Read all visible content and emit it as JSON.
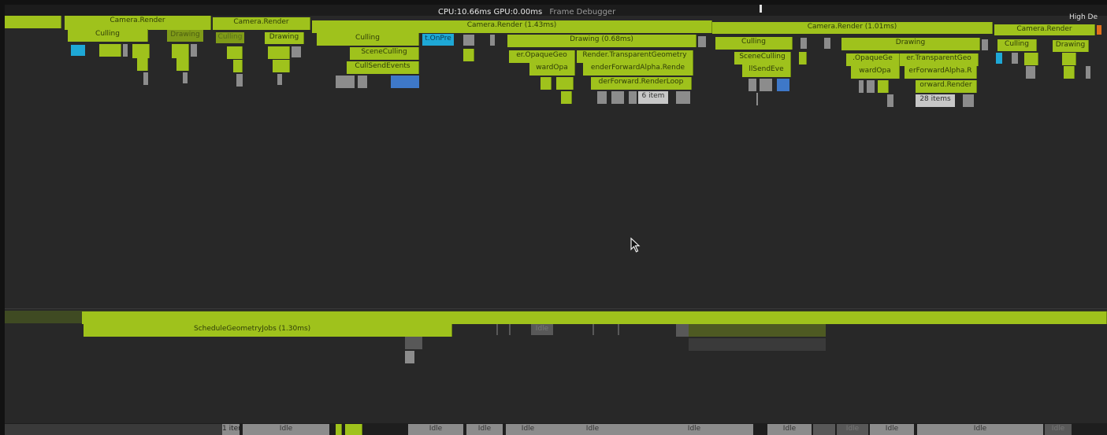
{
  "header": {
    "cpu": "CPU:10.66ms",
    "gpu": "GPU:0.00ms",
    "frame_debugger": "Frame Debugger",
    "high_detail": "High De"
  },
  "blocks": {
    "cam1": "Camera.Render",
    "cam2": "Camera.Render",
    "cam3": "Camera.Render (1.43ms)",
    "cam4": "Camera.Render (1.01ms)",
    "cam5": "Camera.Render",
    "cull1": "Culling",
    "draw1": "Drawing",
    "cull2": "Culling",
    "draw2": "Drawing",
    "cull3": "Culling",
    "onpre": "t.OnPre",
    "draw3": "Drawing (0.68ms)",
    "cull4": "Culling",
    "draw4": "Drawing",
    "cull5": "Culling",
    "draw5": "Drawing",
    "scene1": "SceneCulling",
    "cullsend1": "CullSendEvents",
    "opaque1": "er.OpaqueGeo",
    "transp1": "Render.TransparentGeometry",
    "fwdopa1": "wardOpa",
    "fwdalpha1": "enderForwardAlpha.Rende",
    "fwdloop1": "derForward.RenderLoop",
    "items1": "6 item",
    "scene2": "SceneCulling",
    "cullsend2": "llSendEve",
    "opaque2": ".OpaqueGe",
    "transp2": "er.TransparentGeo",
    "fwdopa2": "wardOpa",
    "fwdalpha2": "erForwardAlpha.R",
    "fwdrend2": "orward.Render",
    "items2": "28 items",
    "schedule": "ScheduleGeometryJobs (1.30ms)",
    "idle_text": "Idle",
    "bot_iter": "1 iter",
    "bot_idle1": "Idle",
    "bot_idle2": "Idle",
    "bot_idle3": "Idle",
    "bot_idle4": "Idle",
    "bot_idle5": "Idle",
    "bot_idle6": "Idle",
    "bot_idle7": "Idle",
    "bot_idle8": "Idle",
    "bot_idle9": "Idle",
    "bot_idle10": "Idle",
    "bot_idle11": "Idle"
  },
  "colors": {
    "marker_green": "#9fc21c",
    "background": "#282828"
  },
  "icons": {
    "cursor": "arrow-cursor-icon"
  }
}
